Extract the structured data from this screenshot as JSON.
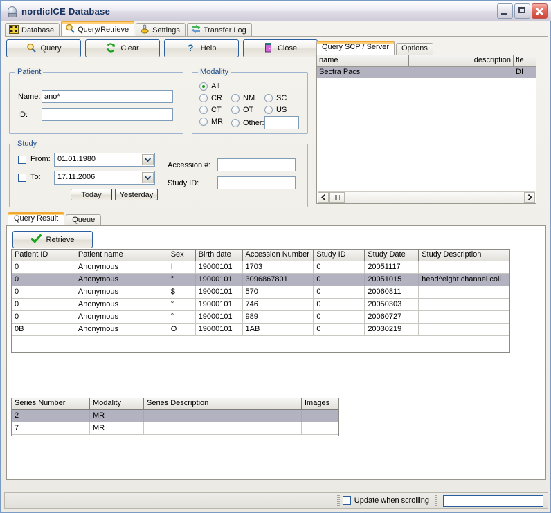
{
  "window": {
    "title": "nordicICE Database",
    "icon": "app-icon",
    "controls": {
      "minimize": "–",
      "maximize": "□",
      "close": "✕"
    }
  },
  "tabs": [
    {
      "label": "Database",
      "icon": "database-icon",
      "active": false
    },
    {
      "label": "Query/Retrieve",
      "icon": "magnifier-icon",
      "active": true
    },
    {
      "label": "Settings",
      "icon": "gear-icon",
      "active": false
    },
    {
      "label": "Transfer Log",
      "icon": "transfer-icon",
      "active": false
    }
  ],
  "toolbar": [
    {
      "label": "Query",
      "icon": "magnifier-icon"
    },
    {
      "label": "Clear",
      "icon": "refresh-icon"
    },
    {
      "label": "Help",
      "icon": "question-icon"
    },
    {
      "label": "Close",
      "icon": "door-icon"
    }
  ],
  "patient": {
    "legend": "Patient",
    "name_label": "Name:",
    "name_value": "ano*",
    "id_label": "ID:",
    "id_value": ""
  },
  "modality": {
    "legend": "Modality",
    "options": [
      {
        "label": "All",
        "selected": true
      },
      {
        "label": "CR",
        "selected": false
      },
      {
        "label": "CT",
        "selected": false
      },
      {
        "label": "MR",
        "selected": false
      },
      {
        "label": "NM",
        "selected": false
      },
      {
        "label": "OT",
        "selected": false
      },
      {
        "label": "SC",
        "selected": false
      },
      {
        "label": "US",
        "selected": false
      },
      {
        "label": "Other:",
        "selected": false
      }
    ],
    "other_value": ""
  },
  "study": {
    "legend": "Study",
    "from_label": "From:",
    "from_checked": false,
    "from_value": "01.01.1980",
    "to_label": "To:",
    "to_checked": false,
    "to_value": "17.11.2006",
    "today_label": "Today",
    "yesterday_label": "Yesterday",
    "accession_label": "Accession #:",
    "accession_value": "",
    "study_id_label": "Study ID:",
    "study_id_value": ""
  },
  "server_panel": {
    "tabs": [
      {
        "label": "Query SCP / Server",
        "active": true
      },
      {
        "label": "Options",
        "active": false
      }
    ],
    "columns": [
      "name",
      "description",
      "tle"
    ],
    "rows": [
      {
        "name": "Sectra Pacs",
        "description": "",
        "tle": "DI",
        "selected": true
      }
    ],
    "scrollbar": {
      "left_arrow": "◀",
      "right_arrow": "▶"
    }
  },
  "result_panel": {
    "tabs": [
      {
        "label": "Query Result",
        "active": true
      },
      {
        "label": "Queue",
        "active": false
      }
    ],
    "retrieve_label": "Retrieve",
    "retrieve_icon": "checkmark-icon",
    "study_table": {
      "columns": [
        "Patient ID",
        "Patient name",
        "Sex",
        "Birth date",
        "Accession Number",
        "Study ID",
        "Study Date",
        "Study Description"
      ],
      "rows": [
        {
          "cells": [
            "0",
            "Anonymous",
            "I",
            "19000101",
            "1703",
            "0",
            "20051117",
            ""
          ],
          "selected": false
        },
        {
          "cells": [
            "0",
            "Anonymous",
            "°",
            "19000101",
            "3096867801",
            "0",
            "20051015",
            "head^eight channel coil"
          ],
          "selected": true
        },
        {
          "cells": [
            "0",
            "Anonymous",
            "$",
            "19000101",
            "570",
            "0",
            "20060811",
            ""
          ],
          "selected": false
        },
        {
          "cells": [
            "0",
            "Anonymous",
            "°",
            "19000101",
            "746",
            "0",
            "20050303",
            ""
          ],
          "selected": false
        },
        {
          "cells": [
            "0",
            "Anonymous",
            "°",
            "19000101",
            "989",
            "0",
            "20060727",
            ""
          ],
          "selected": false
        },
        {
          "cells": [
            "0B",
            "Anonymous",
            "O",
            "19000101",
            "1AB",
            "0",
            "20030219",
            ""
          ],
          "selected": false
        }
      ]
    },
    "series_table": {
      "columns": [
        "Series Number",
        "Modality",
        "Series Description",
        "Images"
      ],
      "rows": [
        {
          "cells": [
            "2",
            "MR",
            "",
            ""
          ],
          "selected": true
        },
        {
          "cells": [
            "7",
            "MR",
            "",
            ""
          ],
          "selected": false
        }
      ]
    }
  },
  "statusbar": {
    "update_label": "Update when scrolling",
    "update_checked": false,
    "field_value": ""
  },
  "colors": {
    "accent": "#f0a830",
    "tab_active_bg": "#ffffff",
    "selection": "#b2b2c0",
    "legend_text": "#1a4a8a",
    "title_text": "#17335e"
  }
}
